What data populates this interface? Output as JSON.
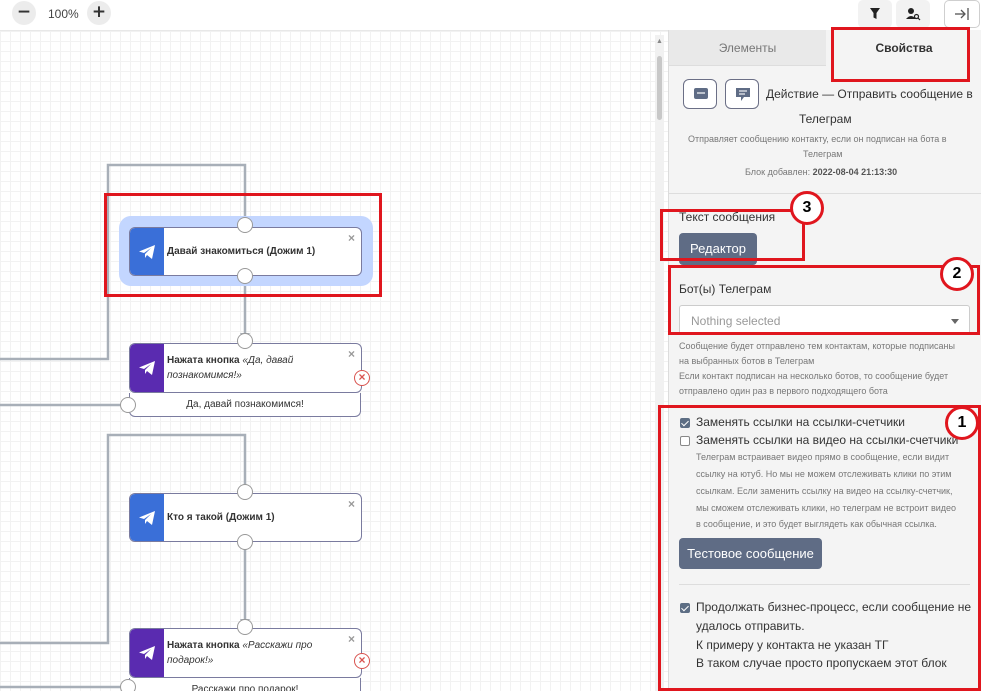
{
  "toolbar": {
    "zoom_out_label": "−",
    "zoom_level": "100%",
    "zoom_in_label": "+",
    "filter_icon": "filter-icon",
    "user_search_icon": "user-search-icon",
    "collapse_icon": "collapse-panel-icon"
  },
  "canvas": {
    "nodes": [
      {
        "title": "Давай знакомиться (Дожим 1)",
        "close": "×"
      },
      {
        "title_prefix": "Нажата кнопка ",
        "title_italic": "«Да, давай познакомимся!»",
        "close": "×",
        "output": "Да, давай познакомимся!",
        "error": "×"
      },
      {
        "title": "Кто я такой (Дожим 1)",
        "close": "×"
      },
      {
        "title_prefix": "Нажата кнопка ",
        "title_italic": "«Расскажи про подарок!»",
        "close": "×",
        "output": "Расскажи про подарок!",
        "error": "×"
      }
    ],
    "colors": {
      "telegram_blue": "#3a6fd8",
      "button_purple": "#5a2bb0",
      "selection": "#c3d6ff",
      "annotation_red": "#e0161e"
    }
  },
  "panel": {
    "tabs": [
      {
        "label": "Элементы"
      },
      {
        "label": "Свойства"
      }
    ],
    "action_title_line1": "Действие — Отправить сообщение в",
    "action_title_line2": "Телеграм",
    "description_line1": "Отправляет сообщению контакту, если он подписан на бота в",
    "description_line2": "Телеграм",
    "added_label": "Блок добавлен: ",
    "added_date": "2022-08-04 21:13:30",
    "message_text_label": "Текст сообщения",
    "editor_button": "Редактор",
    "bots_label": "Бот(ы) Телеграм",
    "bots_placeholder": "Nothing selected",
    "bots_help_1": "Сообщение будет отправлено тем контактам, которые подписаны",
    "bots_help_2": "на выбранных ботов в Телеграм",
    "bots_help_3": "Если контакт подписан на несколько ботов, то сообщение будет",
    "bots_help_4": "отправлено один раз в первого подходящего бота",
    "replace_links_label": "Заменять ссылки на ссылки-счетчики",
    "replace_links_checked": true,
    "replace_video_label": "Заменять ссылки на видео на ссылки-счетчики",
    "replace_video_checked": false,
    "video_help_1": "Телеграм встраивает видео прямо в сообщение, если видит",
    "video_help_2": "ссылку на ютуб. Но мы не можем отслеживать клики по этим",
    "video_help_3": "ссылкам. Если заменить ссылку на видео на ссылку-счетчик,",
    "video_help_4": "мы сможем отслеживать клики, но телеграм не встроит видео",
    "video_help_5": "в сообщение, и это будет выглядеть как обычная ссылка.",
    "test_button": "Тестовое сообщение",
    "continue_label_1": "Продолжать бизнес-процесс, если сообщение не",
    "continue_label_2": "удалось отправить.",
    "continue_label_3": "К примеру у контакта не указан ТГ",
    "continue_label_4": "В таком случае просто пропускаем этот блок",
    "continue_checked": true
  },
  "annotations": {
    "badge_1": "1",
    "badge_2": "2",
    "badge_3": "3"
  }
}
